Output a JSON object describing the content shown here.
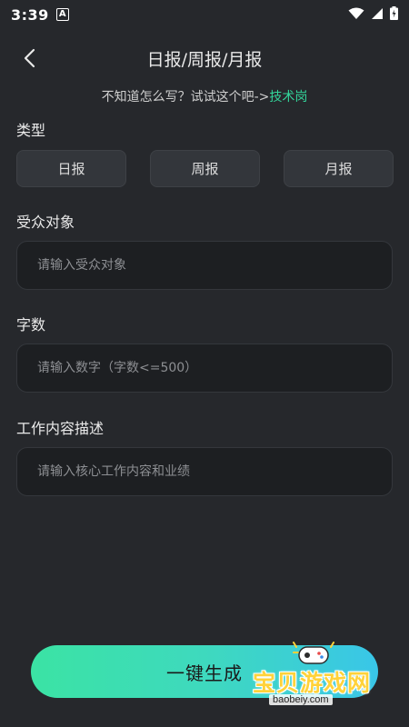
{
  "status_bar": {
    "time": "3:39",
    "badge": "A"
  },
  "header": {
    "title": "日报/周报/月报"
  },
  "hint": {
    "prefix": "不知道怎么写？试试这个吧->",
    "link": "技术岗"
  },
  "type_section": {
    "label": "类型",
    "options": [
      "日报",
      "周报",
      "月报"
    ]
  },
  "audience": {
    "label": "受众对象",
    "placeholder": "请输入受众对象"
  },
  "word_count": {
    "label": "字数",
    "placeholder": "请输入数字（字数<=500）"
  },
  "work_desc": {
    "label": "工作内容描述",
    "placeholder": "请输入核心工作内容和业绩"
  },
  "generate": {
    "label": "一键生成"
  },
  "watermark": {
    "text": "宝贝游戏网",
    "url": "baobeiy.com"
  },
  "colors": {
    "background": "#26282c",
    "accent_link": "#33d49a",
    "button_gradient_start": "#3be3a4",
    "button_gradient_end": "#39c6e8"
  }
}
